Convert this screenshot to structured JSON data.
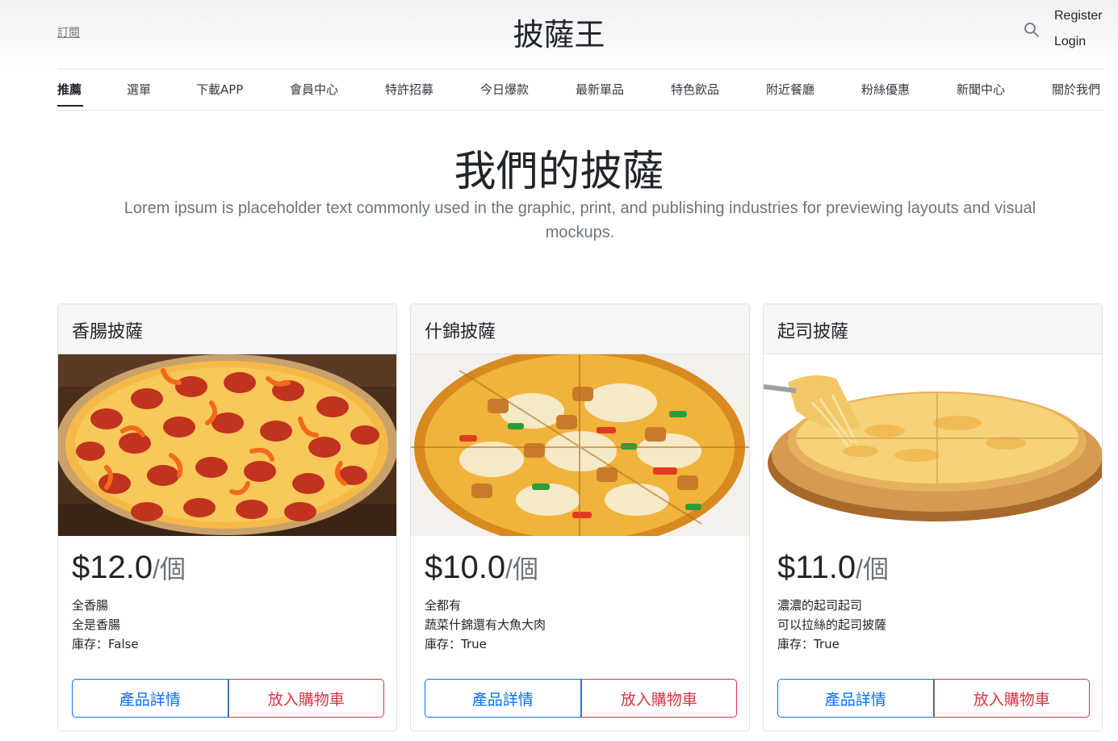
{
  "header": {
    "subscribe_label": "訂閱",
    "brand": "披薩王",
    "search_icon": "search-icon",
    "register_label": "Register",
    "login_label": "Login"
  },
  "nav": {
    "items": [
      {
        "label": "推薦",
        "active": true
      },
      {
        "label": "選單"
      },
      {
        "label": "下載APP"
      },
      {
        "label": "會員中心"
      },
      {
        "label": "特許招募"
      },
      {
        "label": "今日爆款"
      },
      {
        "label": "最新單品"
      },
      {
        "label": "特色飲品"
      },
      {
        "label": "附近餐廳"
      },
      {
        "label": "粉絲優惠"
      },
      {
        "label": "新聞中心"
      },
      {
        "label": "關於我們"
      }
    ]
  },
  "hero": {
    "title": "我們的披薩",
    "text": "Lorem ipsum is placeholder text commonly used in the graphic, print, and publishing industries for previewing layouts and visual mockups."
  },
  "products": [
    {
      "name": "香腸披薩",
      "price": "$12.0",
      "unit": "/個",
      "desc1": "全香腸",
      "desc2": "全是香腸",
      "stock": "庫存：False",
      "detail_label": "產品詳情",
      "cart_label": "放入購物車"
    },
    {
      "name": "什錦披薩",
      "price": "$10.0",
      "unit": "/個",
      "desc1": "全都有",
      "desc2": "蔬菜什錦還有大魚大肉",
      "stock": "庫存：True",
      "detail_label": "產品詳情",
      "cart_label": "放入購物車"
    },
    {
      "name": "起司披薩",
      "price": "$11.0",
      "unit": "/個",
      "desc1": "濃濃的起司起司",
      "desc2": "可以拉絲的起司披薩",
      "stock": "庫存：True",
      "detail_label": "產品詳情",
      "cart_label": "放入購物車"
    }
  ],
  "colors": {
    "primary": "#0d6efd",
    "danger": "#dc3545",
    "muted": "#6c757d"
  }
}
